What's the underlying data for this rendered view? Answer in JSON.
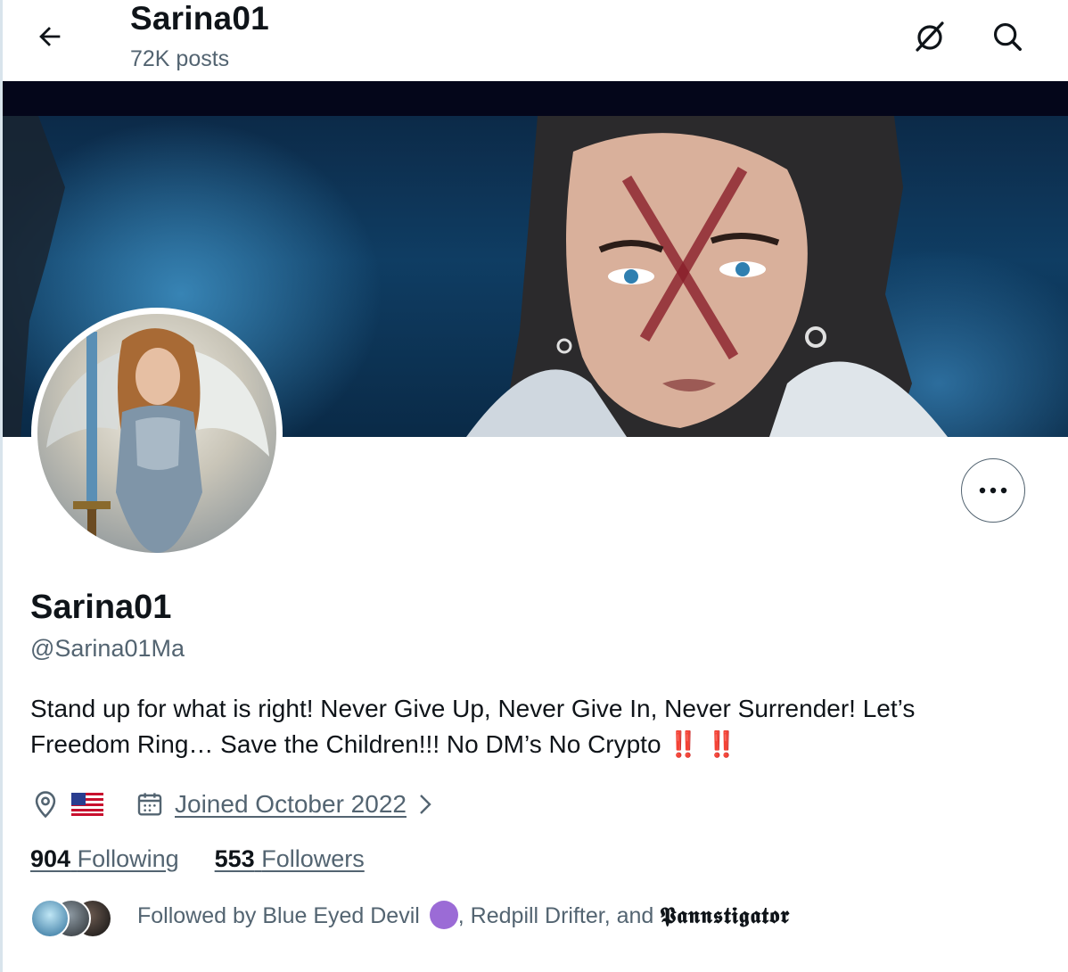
{
  "header": {
    "title": "Sarina01",
    "posts_count": "72K posts"
  },
  "profile": {
    "display_name": "Sarina01",
    "handle": "@Sarina01Ma",
    "bio_text": "Stand up for what is right! Never Give Up, Never Give In, Never Surrender! Let’s Freedom Ring… Save the Children!!! No DM’s No Crypto ",
    "bio_emoji": "‼️ ‼️",
    "location_emoji": "US flag",
    "joined": "Joined October 2022"
  },
  "stats": {
    "following_count": "904",
    "following_label": "Following",
    "followers_count": "553",
    "followers_label": "Followers"
  },
  "followed_by": {
    "prefix": "Followed by Blue Eyed Devil",
    "middle": ", Redpill Drifter, and ",
    "last": "𝕻𝖆𝖓𝖓𝖘𝖙𝖎𝖌𝖆𝖙𝖔𝖗"
  },
  "icons": {
    "back": "arrow-left-icon",
    "grok": "grok-slash-icon",
    "search": "search-icon",
    "more": "more-dots-icon",
    "location": "location-pin-icon",
    "calendar": "calendar-icon",
    "chevron": "chevron-right-icon"
  },
  "colors": {
    "text_primary": "#0f1419",
    "text_secondary": "#536471",
    "emoji_red": "#d6001c"
  }
}
